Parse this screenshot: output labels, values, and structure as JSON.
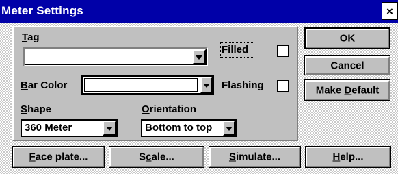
{
  "window": {
    "title": "Meter Settings",
    "close_glyph": "×"
  },
  "form": {
    "tag": {
      "label_mnemonic": "T",
      "label_rest": "ag",
      "value": ""
    },
    "filled": {
      "label": "Filled",
      "checked": false
    },
    "bar_color": {
      "label_mnemonic": "B",
      "label_rest": "ar Color",
      "value": ""
    },
    "flashing": {
      "label": "Flashing",
      "checked": false
    },
    "shape": {
      "label_mnemonic": "S",
      "label_rest": "hape",
      "selected": "360 Meter"
    },
    "orientation": {
      "label_mnemonic": "O",
      "label_rest": "rientation",
      "selected": "Bottom to top"
    }
  },
  "side_buttons": {
    "ok": "OK",
    "cancel": "Cancel",
    "make_default_pre": "Make ",
    "make_default_mnemonic": "D",
    "make_default_post": "efault"
  },
  "bottom_buttons": {
    "face_plate_mnemonic": "F",
    "face_plate_rest": "ace plate...",
    "scale_pre": "S",
    "scale_mnemonic": "c",
    "scale_post": "ale...",
    "simulate_mnemonic": "S",
    "simulate_rest": "imulate...",
    "help_mnemonic": "H",
    "help_rest": "elp..."
  },
  "icons": {
    "dropdown": "chevron-down-icon",
    "close": "close-icon"
  }
}
